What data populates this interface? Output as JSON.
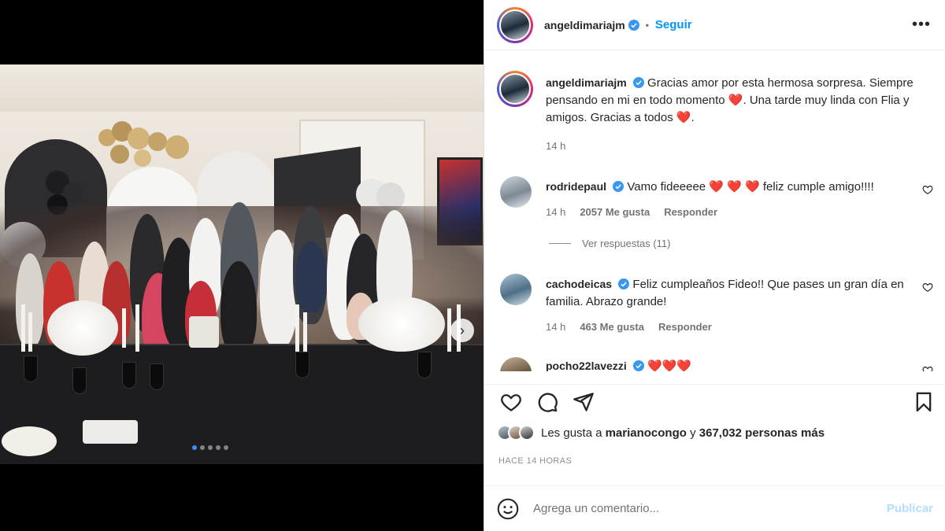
{
  "post": {
    "author": "angeldimariajm",
    "follow_label": "Seguir",
    "more_label": "•••",
    "caption_part1": "Gracias amor por esta hermosa sorpresa. Siempre pensando en mi en todo momento ",
    "caption_part2": ". Una tarde muy linda con Flia y amigos. Gracias a todos ",
    "caption_part3": ".",
    "caption_time": "14 h",
    "heart_glyph": "❤️",
    "carousel_total": 5,
    "carousel_active": 1
  },
  "comments": [
    {
      "user": "rodridepaul",
      "text_before": "Vamo fideeeee ",
      "hearts": "❤️ ❤️ ❤️",
      "text_after": " feliz cumple amigo!!!!",
      "time": "14 h",
      "likes": "2057 Me gusta",
      "reply": "Responder",
      "view_replies": "Ver respuestas (11)"
    },
    {
      "user": "cachodeicas",
      "text": "Feliz cumpleaños Fideo!! Que pases un gran día en familia. Abrazo grande!",
      "time": "14 h",
      "likes": "463 Me gusta",
      "reply": "Responder"
    },
    {
      "user": "pocho22lavezzi",
      "hearts": "❤️❤️❤️"
    }
  ],
  "likes": {
    "prefix": "Les gusta a ",
    "user": "marianocongo",
    "middle": " y ",
    "count": "367,032 personas más"
  },
  "timestamp": "HACE 14 HORAS",
  "composer": {
    "placeholder": "Agrega un comentario...",
    "publish": "Publicar"
  },
  "colors": {
    "accent": "#0095f6",
    "verified": "#3897f0",
    "heart": "#e0245e"
  }
}
